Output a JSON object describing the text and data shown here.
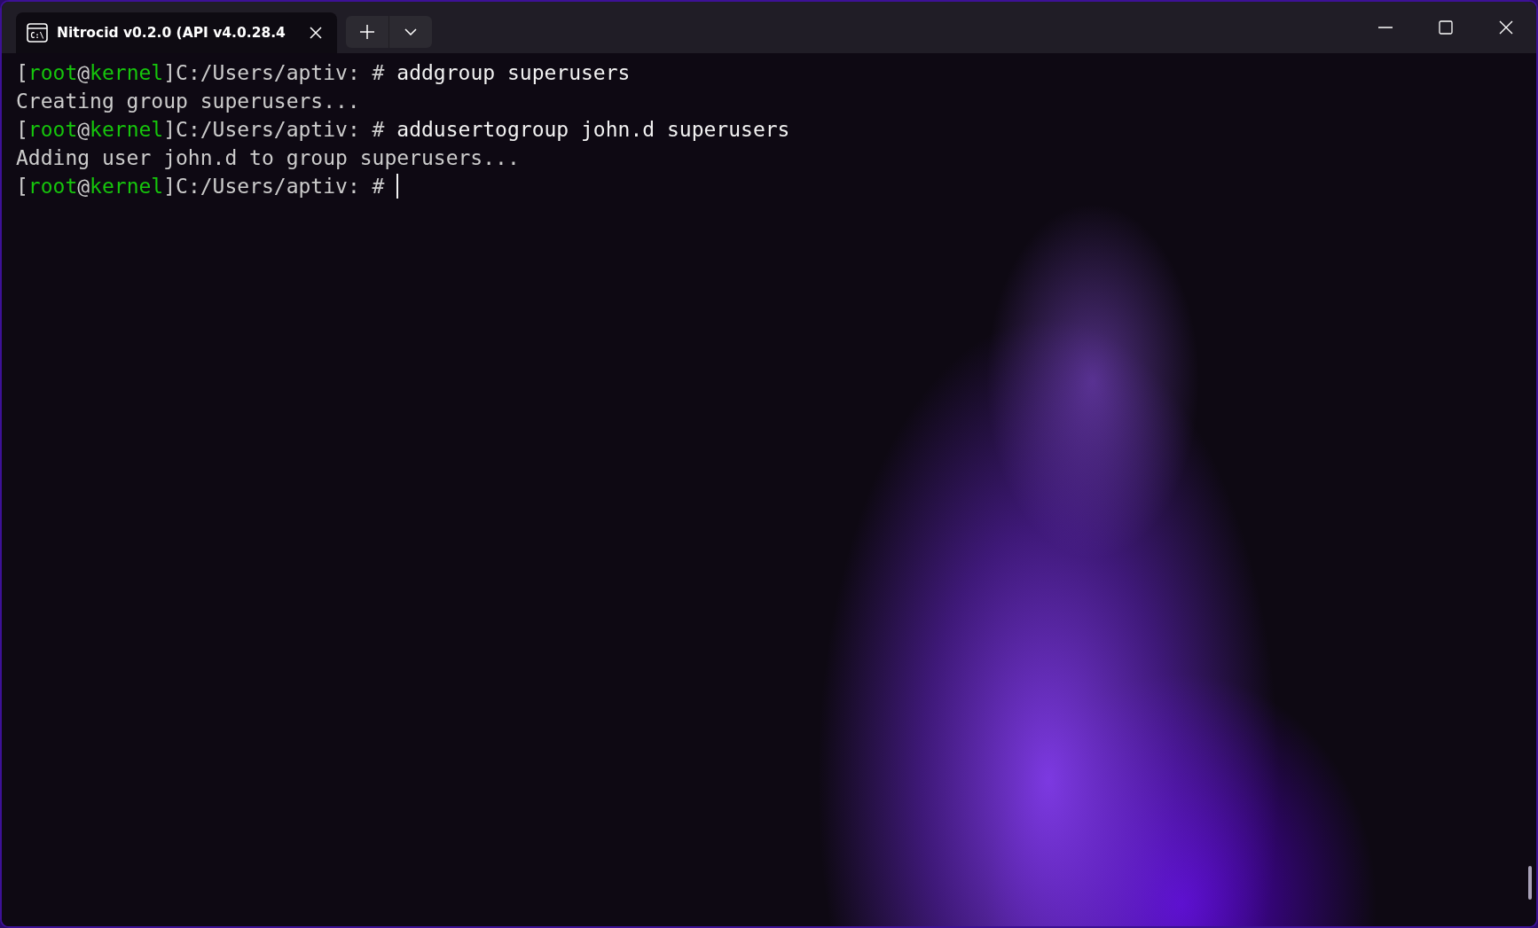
{
  "tabs": [
    {
      "icon_text": "C:\\",
      "label": "Nitrocid v0.2.0 (API v4.0.28.4",
      "selected": true
    }
  ],
  "terminal": {
    "lines": [
      {
        "cursor": false,
        "segments": [
          {
            "text": "[",
            "color": "#cccccc"
          },
          {
            "text": "root",
            "color": "#16c60c"
          },
          {
            "text": "@",
            "color": "#cccccc"
          },
          {
            "text": "kernel",
            "color": "#16c60c"
          },
          {
            "text": "]C:/Users/aptiv: # ",
            "color": "#cccccc"
          },
          {
            "text": "addgroup superusers",
            "color": "#f2f2f2"
          }
        ]
      },
      {
        "cursor": false,
        "segments": [
          {
            "text": "Creating group superusers...",
            "color": "#cccccc"
          }
        ]
      },
      {
        "cursor": false,
        "segments": [
          {
            "text": "[",
            "color": "#cccccc"
          },
          {
            "text": "root",
            "color": "#16c60c"
          },
          {
            "text": "@",
            "color": "#cccccc"
          },
          {
            "text": "kernel",
            "color": "#16c60c"
          },
          {
            "text": "]C:/Users/aptiv: # ",
            "color": "#cccccc"
          },
          {
            "text": "addusertogroup john.d superusers",
            "color": "#f2f2f2"
          }
        ]
      },
      {
        "cursor": false,
        "segments": [
          {
            "text": "Adding user john.d to group superusers...",
            "color": "#cccccc"
          }
        ]
      },
      {
        "cursor": true,
        "segments": [
          {
            "text": "[",
            "color": "#cccccc"
          },
          {
            "text": "root",
            "color": "#16c60c"
          },
          {
            "text": "@",
            "color": "#cccccc"
          },
          {
            "text": "kernel",
            "color": "#16c60c"
          },
          {
            "text": "]C:/Users/aptiv: # ",
            "color": "#cccccc"
          }
        ]
      }
    ]
  }
}
